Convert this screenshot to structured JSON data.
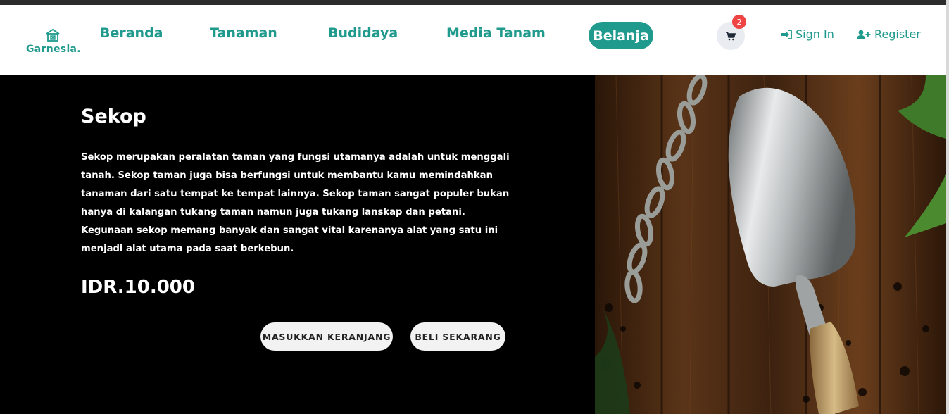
{
  "brand": {
    "name": "Garnesia.",
    "icon": "house-icon",
    "color": "#1f9a8c"
  },
  "nav": {
    "items": [
      {
        "label": "Beranda"
      },
      {
        "label": "Tanaman"
      },
      {
        "label": "Budidaya"
      },
      {
        "label": "Media Tanam"
      },
      {
        "label": "Belanja",
        "active": true
      }
    ]
  },
  "cart": {
    "icon": "cart-icon",
    "count": "2"
  },
  "auth": {
    "sign_in": {
      "label": "Sign In",
      "icon": "sign-in-icon"
    },
    "register": {
      "label": "Register",
      "icon": "user-plus-icon"
    }
  },
  "product": {
    "title": "Sekop",
    "description": "Sekop merupakan peralatan taman yang fungsi utamanya adalah untuk menggali tanah. Sekop taman juga bisa berfungsi untuk membantu kamu memindahkan tanaman dari satu tempat ke tempat lainnya. Sekop taman sangat populer bukan hanya di kalangan tukang taman namun juga tukang lanskap dan petani. Kegunaan sekop memang banyak dan sangat vital karenanya alat yang satu ini menjadi alat utama pada saat berkebun.",
    "price": "IDR.10.000",
    "add_to_cart": "MASUKKAN KERANJANG",
    "buy_now": "BELI SEKARANG",
    "image": "garden-trowel-photo"
  },
  "colors": {
    "accent": "#1f9a8c",
    "badge": "#ef4444",
    "hero_bg": "#000000"
  }
}
